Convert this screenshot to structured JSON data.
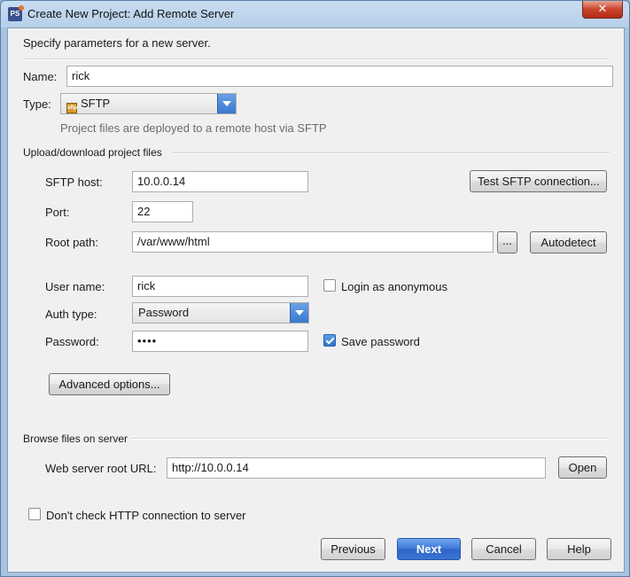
{
  "window": {
    "title": "Create New Project: Add Remote Server",
    "close_glyph": "✕"
  },
  "header": {
    "description": "Specify parameters for a new server."
  },
  "general": {
    "name_label": "Name:",
    "name_value": "rick",
    "type_label": "Type:",
    "type_value": "SFTP",
    "type_icon_text": "sftp",
    "type_hint": "Project files are deployed to a remote host via SFTP"
  },
  "upload": {
    "section_title": "Upload/download project files",
    "host_label": "SFTP host:",
    "host_value": "10.0.0.14",
    "test_button": "Test SFTP connection...",
    "port_label": "Port:",
    "port_value": "22",
    "root_label": "Root path:",
    "root_value": "/var/www/html",
    "browse_button": "...",
    "autodetect_button": "Autodetect",
    "user_label": "User name:",
    "user_value": "rick",
    "anonymous_label": "Login as anonymous",
    "anonymous_checked": false,
    "auth_label": "Auth type:",
    "auth_value": "Password",
    "password_label": "Password:",
    "password_value": "••••",
    "save_password_label": "Save password",
    "save_password_checked": true,
    "advanced_button": "Advanced options..."
  },
  "browse": {
    "section_title": "Browse files on server",
    "url_label": "Web server root URL:",
    "url_value": "http://10.0.0.14",
    "open_button": "Open"
  },
  "footer": {
    "no_http_check_label": "Don't check HTTP connection to server",
    "no_http_check_checked": false,
    "previous_button": "Previous",
    "next_button": "Next",
    "cancel_button": "Cancel",
    "help_button": "Help"
  },
  "colors": {
    "accent": "#3c77d6",
    "title_bar": "#b6cfe8",
    "close": "#c9452e"
  }
}
